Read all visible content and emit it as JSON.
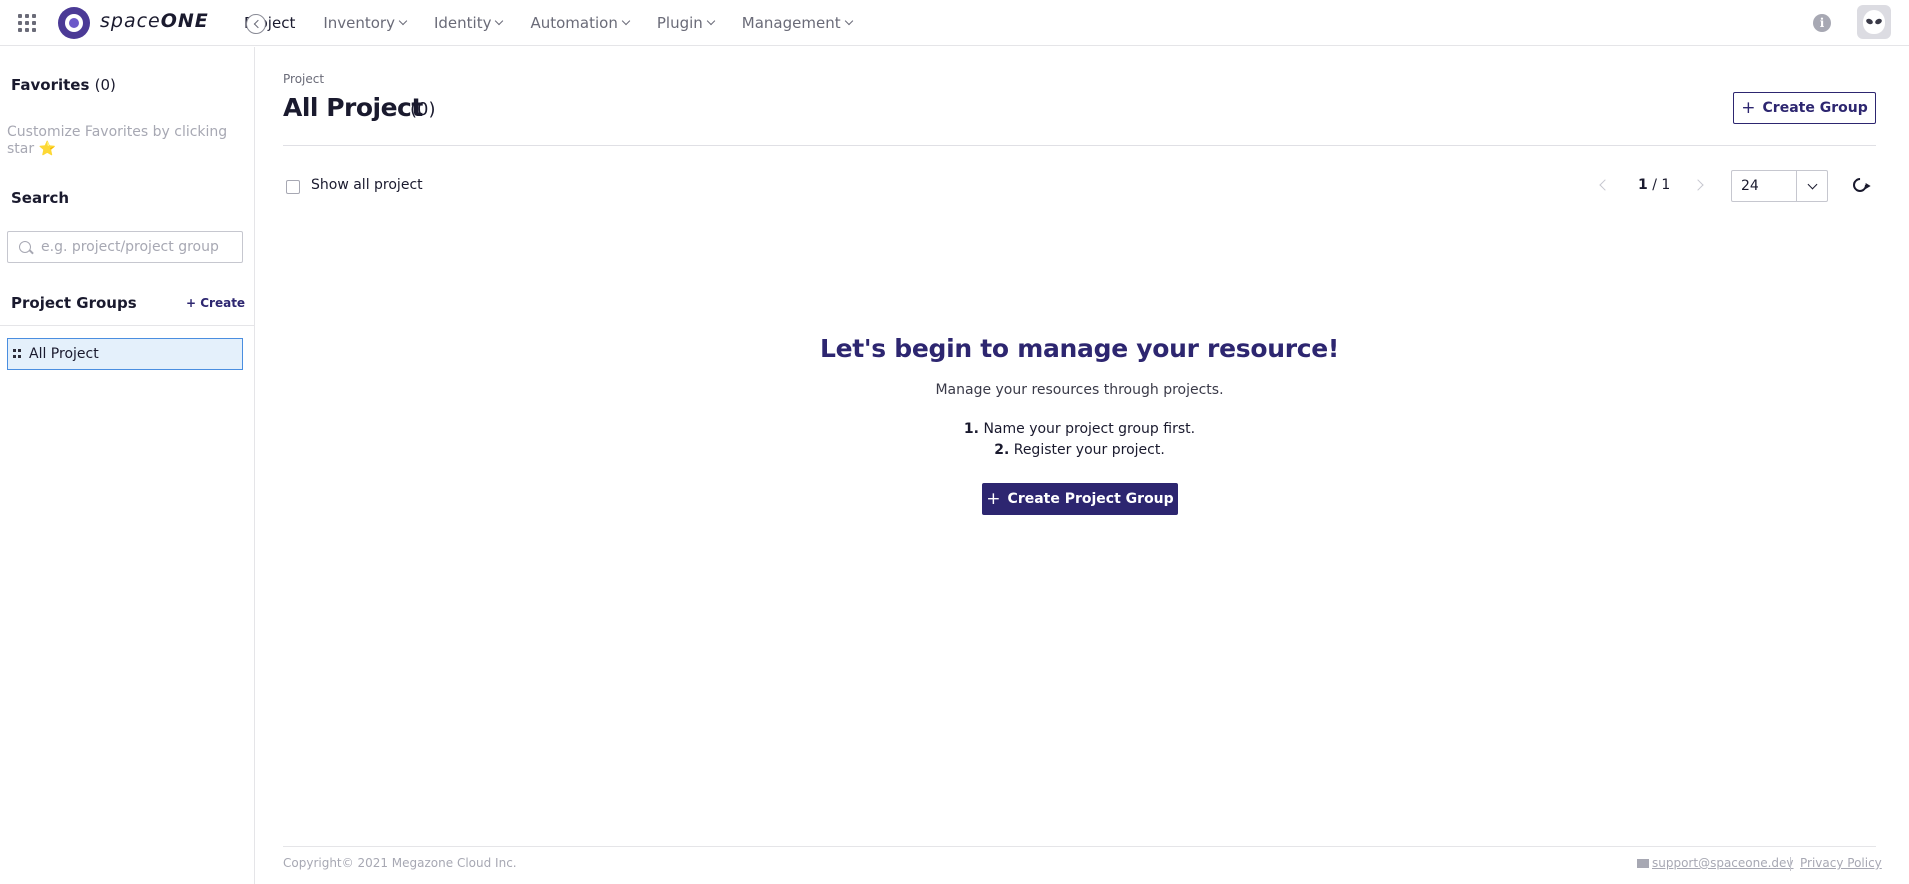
{
  "app": {
    "brand_light": "space",
    "brand_bold": "ONE"
  },
  "nav": {
    "items": [
      {
        "label": "Project",
        "active": true,
        "dropdown": false
      },
      {
        "label": "Inventory",
        "active": false,
        "dropdown": true
      },
      {
        "label": "Identity",
        "active": false,
        "dropdown": true
      },
      {
        "label": "Automation",
        "active": false,
        "dropdown": true
      },
      {
        "label": "Plugin",
        "active": false,
        "dropdown": true
      },
      {
        "label": "Management",
        "active": false,
        "dropdown": true
      }
    ],
    "info_glyph": "i"
  },
  "sidebar": {
    "favorites_label": "Favorites",
    "favorites_count": "(0)",
    "favorites_hint": "Customize Favorites by clicking star",
    "favorites_hint_icon": "⭐",
    "search_label": "Search",
    "search_placeholder": "e.g. project/project group",
    "search_value": "",
    "project_groups_label": "Project Groups",
    "create_label": "Create",
    "tree": [
      {
        "label": "All Project",
        "selected": true
      }
    ]
  },
  "main": {
    "breadcrumb": "Project",
    "title": "All Project",
    "title_count": "(0)",
    "create_group_label": "Create Group",
    "show_all_label": "Show all project",
    "show_all_checked": false,
    "pagination": {
      "current": "1",
      "separator": " / ",
      "total": "1"
    },
    "page_size": "24",
    "empty": {
      "title": "Let's begin to manage your resource!",
      "subtitle": "Manage your resources through projects.",
      "steps": [
        {
          "num": "1.",
          "text": "Name your project group first."
        },
        {
          "num": "2.",
          "text": "Register your project."
        }
      ],
      "cta_label": "Create Project Group"
    }
  },
  "footer": {
    "copyright": "Copyright© 2021 Megazone Cloud Inc.",
    "support_email": "support@spaceone.dev",
    "privacy_label": "Privacy Policy"
  },
  "colors": {
    "primary": "#2d2670",
    "brand_logo": "#4b3a96",
    "selected_bg": "#e4f0fb",
    "selected_border": "#4a8ee0",
    "muted_text": "#a7a8b3"
  }
}
